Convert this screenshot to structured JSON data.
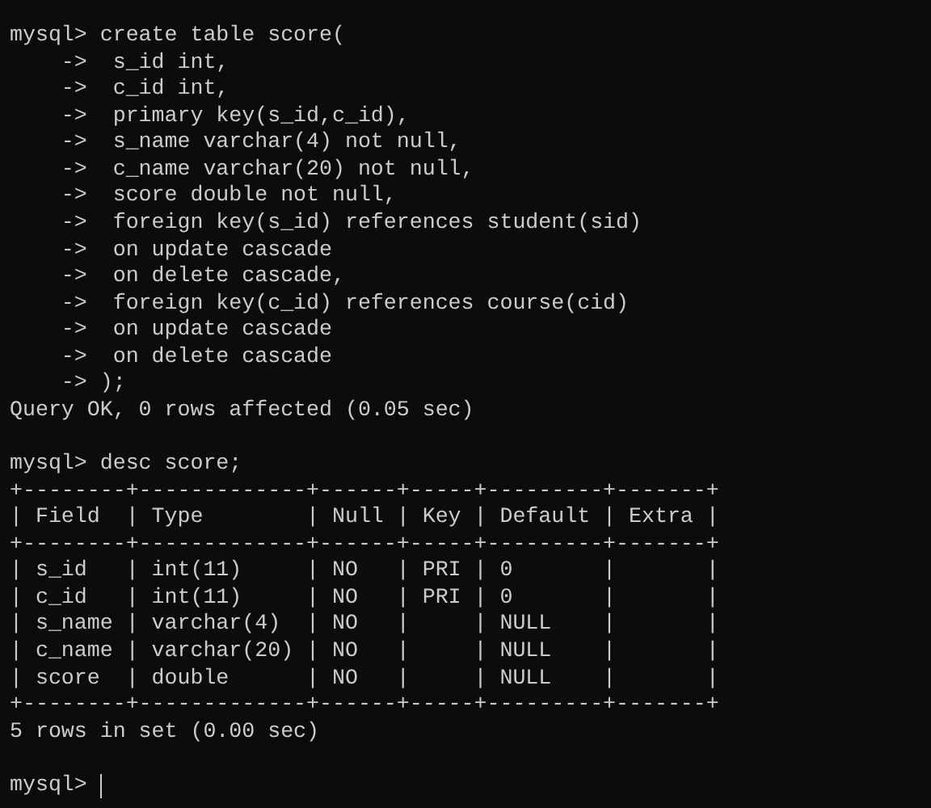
{
  "terminal": {
    "lines": [
      {
        "kind": "line",
        "text": "mysql> create table score("
      },
      {
        "kind": "line",
        "text": "    ->  s_id int,"
      },
      {
        "kind": "line",
        "text": "    ->  c_id int,"
      },
      {
        "kind": "line",
        "text": "    ->  primary key(s_id,c_id),"
      },
      {
        "kind": "line",
        "text": "    ->  s_name varchar(4) not null,"
      },
      {
        "kind": "line",
        "text": "    ->  c_name varchar(20) not null,"
      },
      {
        "kind": "line",
        "text": "    ->  score double not null,"
      },
      {
        "kind": "line",
        "text": "    ->  foreign key(s_id) references student(sid)"
      },
      {
        "kind": "line",
        "text": "    ->  on update cascade"
      },
      {
        "kind": "line",
        "text": "    ->  on delete cascade,"
      },
      {
        "kind": "line",
        "text": "    ->  foreign key(c_id) references course(cid)"
      },
      {
        "kind": "line",
        "text": "    ->  on update cascade"
      },
      {
        "kind": "line",
        "text": "    ->  on delete cascade"
      },
      {
        "kind": "line",
        "text": "    -> );"
      },
      {
        "kind": "line",
        "text": "Query OK, 0 rows affected (0.05 sec)"
      },
      {
        "kind": "blank"
      },
      {
        "kind": "line",
        "text": "mysql> desc score;"
      },
      {
        "kind": "line",
        "text": "+--------+-------------+------+-----+---------+-------+"
      },
      {
        "kind": "line",
        "text": "| Field  | Type        | Null | Key | Default | Extra |"
      },
      {
        "kind": "line",
        "text": "+--------+-------------+------+-----+---------+-------+"
      },
      {
        "kind": "line",
        "text": "| s_id   | int(11)     | NO   | PRI | 0       |       |"
      },
      {
        "kind": "line",
        "text": "| c_id   | int(11)     | NO   | PRI | 0       |       |"
      },
      {
        "kind": "line",
        "text": "| s_name | varchar(4)  | NO   |     | NULL    |       |"
      },
      {
        "kind": "line",
        "text": "| c_name | varchar(20) | NO   |     | NULL    |       |"
      },
      {
        "kind": "line",
        "text": "| score  | double      | NO   |     | NULL    |       |"
      },
      {
        "kind": "line",
        "text": "+--------+-------------+------+-----+---------+-------+"
      },
      {
        "kind": "line",
        "text": "5 rows in set (0.00 sec)"
      },
      {
        "kind": "blank"
      },
      {
        "kind": "prompt",
        "text": "mysql>",
        "cursor": true
      }
    ]
  }
}
